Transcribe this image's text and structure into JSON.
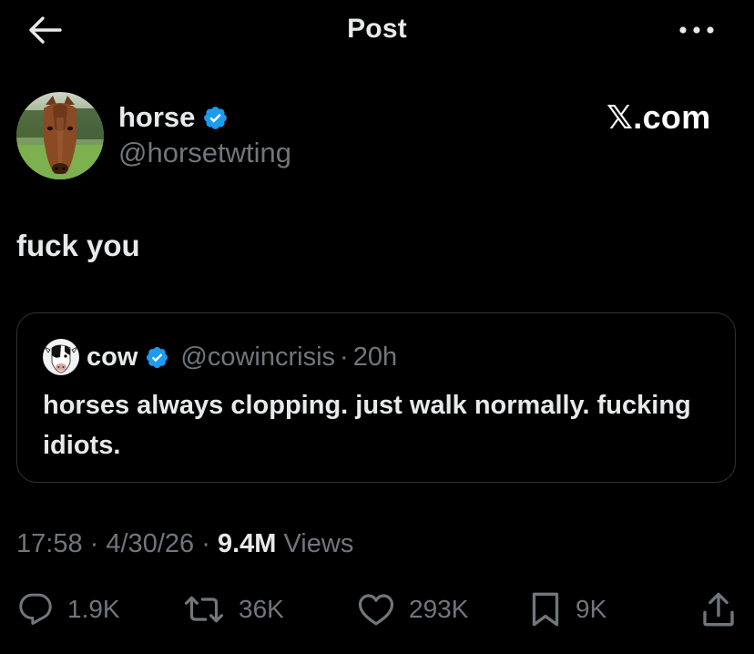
{
  "header": {
    "title": "Post",
    "back_icon": "arrow-left-icon",
    "more_icon": "more-dots-icon"
  },
  "author": {
    "name": "horse",
    "handle": "@horsetwting",
    "verified_color": "#1d9bf0"
  },
  "watermark": "𝕏.com",
  "post": {
    "text": "fuck you"
  },
  "quote": {
    "name": "cow",
    "handle": "@cowincrisis",
    "separator": "·",
    "time": "20h",
    "text": "horses always clopping. just walk normally. fucking idiots."
  },
  "meta": {
    "time": "17:58",
    "sep1": "·",
    "date": "4/30/26",
    "sep2": "·",
    "views_count": "9.4M",
    "views_label": "Views"
  },
  "actions": {
    "replies": "1.9K",
    "reposts": "36K",
    "likes": "293K",
    "bookmarks": "9K"
  },
  "colors": {
    "background": "#000000",
    "text_primary": "#e7e9ea",
    "text_secondary": "#71767b",
    "border": "#2f3336",
    "verified": "#1d9bf0"
  }
}
